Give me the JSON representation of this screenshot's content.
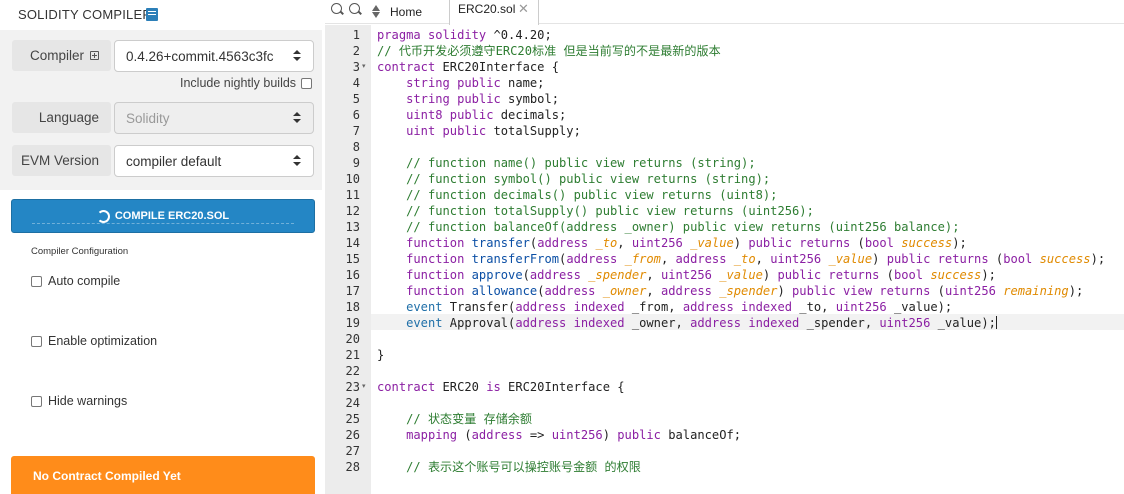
{
  "sidebar": {
    "title": "SOLIDITY COMPILER",
    "compiler_label": "Compiler",
    "compiler_version": "0.4.26+commit.4563c3fc",
    "include_nightly": "Include nightly builds",
    "language_label": "Language",
    "language_value": "Solidity",
    "evm_label": "EVM Version",
    "evm_value": "compiler default",
    "compile_button": "COMPILE ERC20.SOL",
    "config_heading": "Compiler Configuration",
    "options": [
      "Auto compile",
      "Enable optimization",
      "Hide warnings"
    ],
    "status": "No Contract Compiled Yet"
  },
  "editor": {
    "tabs": [
      {
        "label": "Home"
      },
      {
        "label": "ERC20.sol",
        "close": "✕"
      }
    ],
    "active_line": 19,
    "lines": [
      [
        [
          "k",
          "pragma solidity"
        ],
        [
          "t",
          " ^0.4.20;"
        ]
      ],
      [
        [
          "c",
          "// 代币开发必须遵守ERC20标准 但是当前写的不是最新的版本"
        ]
      ],
      [
        [
          "k",
          "contract"
        ],
        [
          "t",
          " ERC20Interface {"
        ]
      ],
      [
        [
          "t",
          "    "
        ],
        [
          "k",
          "string public"
        ],
        [
          "t",
          " name;"
        ]
      ],
      [
        [
          "t",
          "    "
        ],
        [
          "k",
          "string public"
        ],
        [
          "t",
          " symbol;"
        ]
      ],
      [
        [
          "t",
          "    "
        ],
        [
          "k",
          "uint8 public"
        ],
        [
          "t",
          " decimals;"
        ]
      ],
      [
        [
          "t",
          "    "
        ],
        [
          "k",
          "uint public"
        ],
        [
          "t",
          " totalSupply;"
        ]
      ],
      [
        [
          "t",
          ""
        ]
      ],
      [
        [
          "t",
          "    "
        ],
        [
          "c",
          "// function name() public view returns (string);"
        ]
      ],
      [
        [
          "t",
          "    "
        ],
        [
          "c",
          "// function symbol() public view returns (string);"
        ]
      ],
      [
        [
          "t",
          "    "
        ],
        [
          "c",
          "// function decimals() public view returns (uint8);"
        ]
      ],
      [
        [
          "t",
          "    "
        ],
        [
          "c",
          "// function totalSupply() public view returns (uint256);"
        ]
      ],
      [
        [
          "t",
          "    "
        ],
        [
          "c",
          "// function balanceOf(address _owner) public view returns (uint256 balance);"
        ]
      ],
      [
        [
          "t",
          "    "
        ],
        [
          "k",
          "function"
        ],
        [
          "t",
          " "
        ],
        [
          "p",
          "transfer"
        ],
        [
          "t",
          "("
        ],
        [
          "k",
          "address"
        ],
        [
          "t",
          " "
        ],
        [
          "i",
          "_to"
        ],
        [
          "t",
          ", "
        ],
        [
          "k",
          "uint256"
        ],
        [
          "t",
          " "
        ],
        [
          "i",
          "_value"
        ],
        [
          "t",
          ") "
        ],
        [
          "k",
          "public returns"
        ],
        [
          "t",
          " ("
        ],
        [
          "k",
          "bool"
        ],
        [
          "t",
          " "
        ],
        [
          "i",
          "success"
        ],
        [
          "t",
          ");"
        ]
      ],
      [
        [
          "t",
          "    "
        ],
        [
          "k",
          "function"
        ],
        [
          "t",
          " "
        ],
        [
          "p",
          "transferFrom"
        ],
        [
          "t",
          "("
        ],
        [
          "k",
          "address"
        ],
        [
          "t",
          " "
        ],
        [
          "i",
          "_from"
        ],
        [
          "t",
          ", "
        ],
        [
          "k",
          "address"
        ],
        [
          "t",
          " "
        ],
        [
          "i",
          "_to"
        ],
        [
          "t",
          ", "
        ],
        [
          "k",
          "uint256"
        ],
        [
          "t",
          " "
        ],
        [
          "i",
          "_value"
        ],
        [
          "t",
          ") "
        ],
        [
          "k",
          "public returns"
        ],
        [
          "t",
          " ("
        ],
        [
          "k",
          "bool"
        ],
        [
          "t",
          " "
        ],
        [
          "i",
          "success"
        ],
        [
          "t",
          ");"
        ]
      ],
      [
        [
          "t",
          "    "
        ],
        [
          "k",
          "function"
        ],
        [
          "t",
          " "
        ],
        [
          "p",
          "approve"
        ],
        [
          "t",
          "("
        ],
        [
          "k",
          "address"
        ],
        [
          "t",
          " "
        ],
        [
          "i",
          "_spender"
        ],
        [
          "t",
          ", "
        ],
        [
          "k",
          "uint256"
        ],
        [
          "t",
          " "
        ],
        [
          "i",
          "_value"
        ],
        [
          "t",
          ") "
        ],
        [
          "k",
          "public returns"
        ],
        [
          "t",
          " ("
        ],
        [
          "k",
          "bool"
        ],
        [
          "t",
          " "
        ],
        [
          "i",
          "success"
        ],
        [
          "t",
          ");"
        ]
      ],
      [
        [
          "t",
          "    "
        ],
        [
          "k",
          "function"
        ],
        [
          "t",
          " "
        ],
        [
          "p",
          "allowance"
        ],
        [
          "t",
          "("
        ],
        [
          "k",
          "address"
        ],
        [
          "t",
          " "
        ],
        [
          "i",
          "_owner"
        ],
        [
          "t",
          ", "
        ],
        [
          "k",
          "address"
        ],
        [
          "t",
          " "
        ],
        [
          "i",
          "_spender"
        ],
        [
          "t",
          ") "
        ],
        [
          "k",
          "public view returns"
        ],
        [
          "t",
          " ("
        ],
        [
          "k",
          "uint256"
        ],
        [
          "t",
          " "
        ],
        [
          "i",
          "remaining"
        ],
        [
          "t",
          ");"
        ]
      ],
      [
        [
          "t",
          "    "
        ],
        [
          "e",
          "event"
        ],
        [
          "t",
          " Transfer("
        ],
        [
          "k",
          "address indexed"
        ],
        [
          "t",
          " _from, "
        ],
        [
          "k",
          "address indexed"
        ],
        [
          "t",
          " _to, "
        ],
        [
          "k",
          "uint256"
        ],
        [
          "t",
          " _value);"
        ]
      ],
      [
        [
          "t",
          "    "
        ],
        [
          "e",
          "event"
        ],
        [
          "t",
          " Approval("
        ],
        [
          "k",
          "address indexed"
        ],
        [
          "t",
          " _owner, "
        ],
        [
          "k",
          "address indexed"
        ],
        [
          "t",
          " _spender, "
        ],
        [
          "k",
          "uint256"
        ],
        [
          "t",
          " _value);"
        ]
      ],
      [
        [
          "t",
          ""
        ]
      ],
      [
        [
          "t",
          "}"
        ]
      ],
      [
        [
          "t",
          ""
        ]
      ],
      [
        [
          "k",
          "contract"
        ],
        [
          "t",
          " ERC20 "
        ],
        [
          "k",
          "is"
        ],
        [
          "t",
          " ERC20Interface {"
        ]
      ],
      [
        [
          "t",
          ""
        ]
      ],
      [
        [
          "t",
          "    "
        ],
        [
          "c",
          "// 状态变量 存储余额"
        ]
      ],
      [
        [
          "t",
          "    "
        ],
        [
          "k",
          "mapping"
        ],
        [
          "t",
          " ("
        ],
        [
          "k",
          "address"
        ],
        [
          "t",
          " => "
        ],
        [
          "k",
          "uint256"
        ],
        [
          "t",
          ") "
        ],
        [
          "k",
          "public"
        ],
        [
          "t",
          " balanceOf;"
        ]
      ],
      [
        [
          "t",
          ""
        ]
      ],
      [
        [
          "t",
          "    "
        ],
        [
          "c",
          "// 表示这个账号可以操控账号金额 的权限"
        ]
      ]
    ]
  }
}
